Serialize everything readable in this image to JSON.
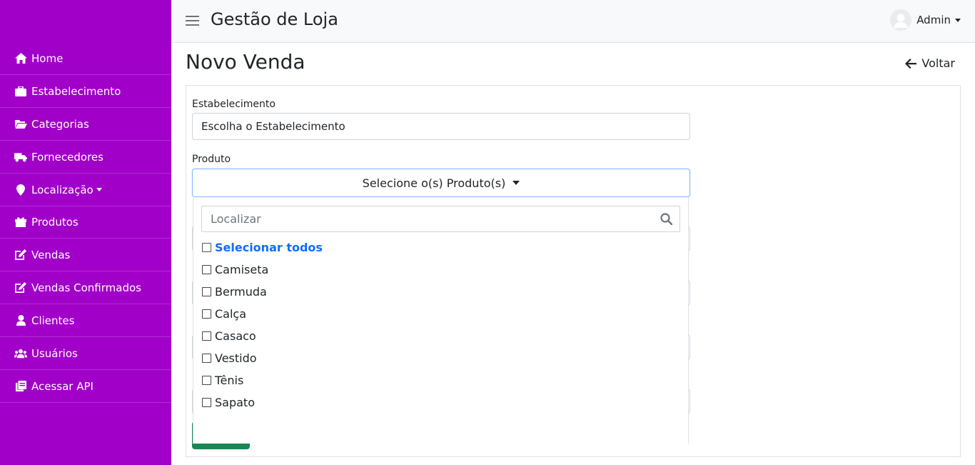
{
  "colors": {
    "sidebar_bg": "#a100c8",
    "accent": "#0d6efd",
    "success": "#198754"
  },
  "sidebar": {
    "items": [
      {
        "label": "Home",
        "icon": "home-icon"
      },
      {
        "label": "Estabelecimento",
        "icon": "briefcase-icon"
      },
      {
        "label": "Categorias",
        "icon": "folder-open-icon"
      },
      {
        "label": "Fornecedores",
        "icon": "truck-icon"
      },
      {
        "label": "Localização",
        "icon": "map-marker-icon"
      },
      {
        "label": "Produtos",
        "icon": "gift-icon"
      },
      {
        "label": "Vendas",
        "icon": "edit-icon"
      },
      {
        "label": "Vendas Confirmados",
        "icon": "edit-icon"
      },
      {
        "label": "Clientes",
        "icon": "user-icon"
      },
      {
        "label": "Usuários",
        "icon": "users-icon"
      },
      {
        "label": "Acessar API",
        "icon": "copy-icon"
      }
    ]
  },
  "header": {
    "title": "Gestão de Loja",
    "user_name": "Admin"
  },
  "page": {
    "title": "Novo Venda",
    "back_label": "Voltar"
  },
  "form": {
    "estabelecimento_label": "Estabelecimento",
    "estabelecimento_value": "Escolha o Estabelecimento",
    "produto_label": "Produto",
    "produto_select_label": "Selecione o(s) Produto(s)"
  },
  "dropdown": {
    "search_placeholder": "Localizar",
    "select_all_label": "Selecionar todos",
    "options": [
      "Camiseta",
      "Bermuda",
      "Calça",
      "Casaco",
      "Vestido",
      "Tênis",
      "Sapato"
    ]
  }
}
